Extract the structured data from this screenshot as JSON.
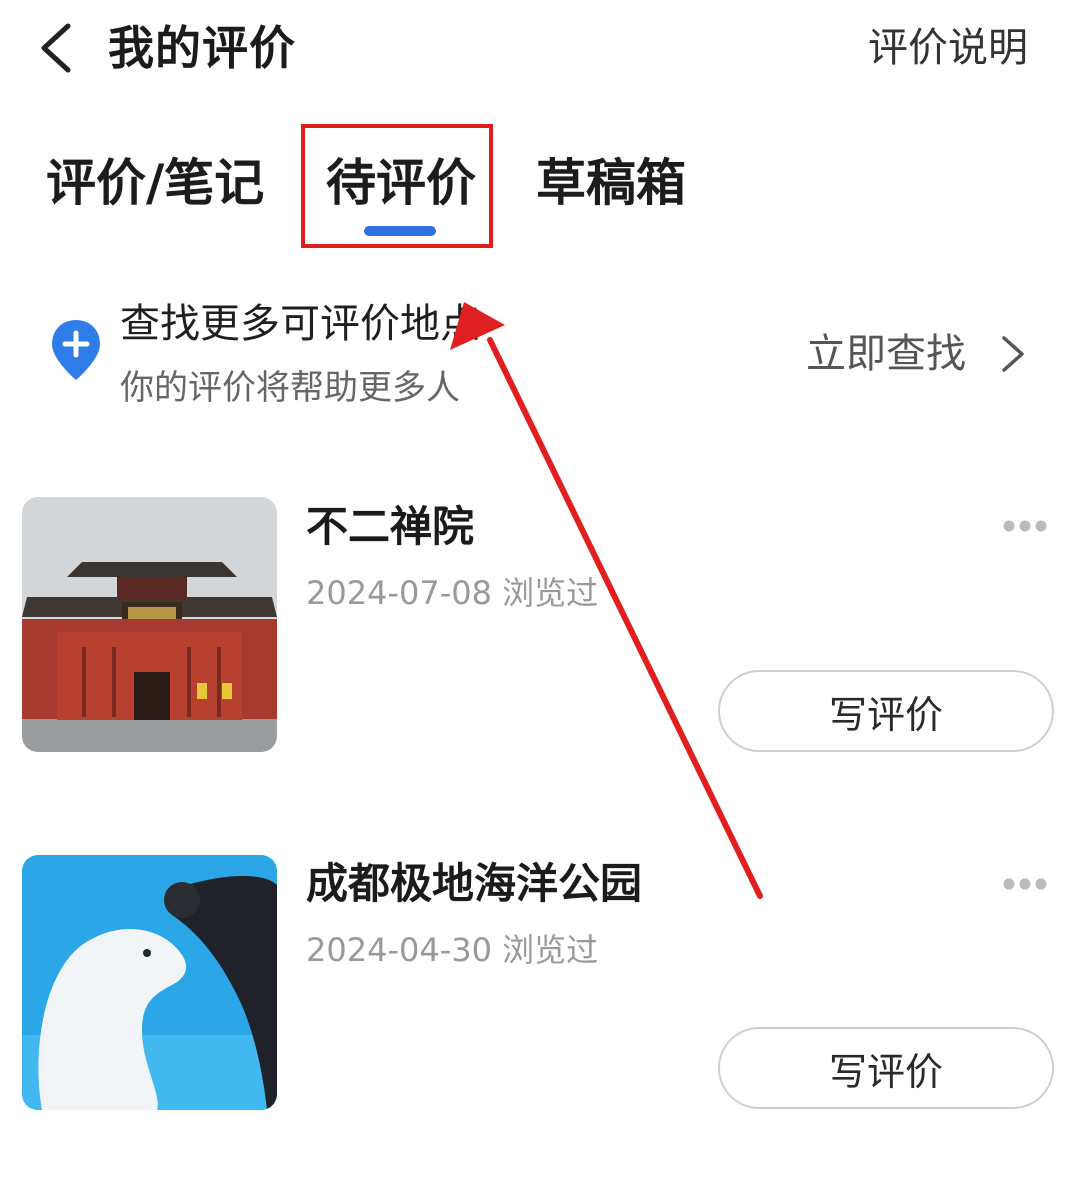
{
  "header": {
    "title": "我的评价",
    "help_label": "评价说明"
  },
  "tabs": [
    {
      "label": "评价/笔记",
      "active": false
    },
    {
      "label": "待评价",
      "active": true
    },
    {
      "label": "草稿箱",
      "active": false
    }
  ],
  "find_more": {
    "title": "查找更多可评价地点",
    "subtitle": "你的评价将帮助更多人",
    "link_label": "立即查找",
    "icon": "location-plus-icon"
  },
  "items": [
    {
      "name": "不二禅院",
      "date": "2024-07-08 浏览过",
      "button_label": "写评价",
      "image": "temple-photo"
    },
    {
      "name": "成都极地海洋公园",
      "date": "2024-04-30 浏览过",
      "button_label": "写评价",
      "image": "beluga-photo"
    }
  ],
  "colors": {
    "accent": "#2f6fe0",
    "annotation_red": "#e02020"
  }
}
